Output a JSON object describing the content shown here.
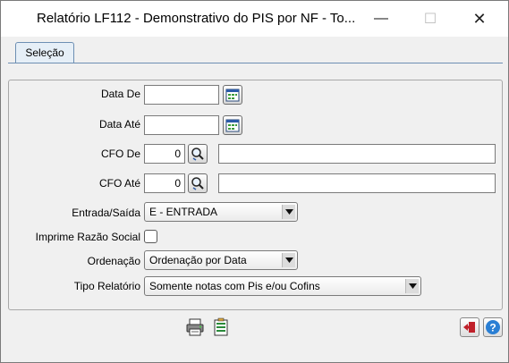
{
  "window": {
    "title": "Relatório LF112 - Demonstrativo do PIS por NF - To...",
    "minimize_glyph": "—",
    "maximize_glyph": "☐",
    "close_glyph": "✕"
  },
  "tabs": [
    {
      "label": "Seleção"
    }
  ],
  "form": {
    "data_de": {
      "label": "Data De",
      "value": ""
    },
    "data_ate": {
      "label": "Data Até",
      "value": ""
    },
    "cfo_de": {
      "label": "CFO De",
      "value": "0",
      "description": ""
    },
    "cfo_ate": {
      "label": "CFO Até",
      "value": "0",
      "description": ""
    },
    "entrada_saida": {
      "label": "Entrada/Saída",
      "value": "E - ENTRADA"
    },
    "imprime_razao_social": {
      "label": "Imprime Razão Social",
      "checked": false
    },
    "ordenacao": {
      "label": "Ordenação",
      "value": "Ordenação por Data"
    },
    "tipo_relatorio": {
      "label": "Tipo Relatório",
      "value": "Somente notas com Pis e/ou Cofins"
    }
  },
  "icons": {
    "calendar": "calendar-icon",
    "search": "search-icon",
    "print": "printer-icon",
    "export": "export-icon",
    "exit": "exit-icon",
    "help": "help-icon"
  },
  "colors": {
    "tab_border": "#6d8fb3",
    "tab_fill": "#e6eff7",
    "exit_red": "#c0202a",
    "help_blue": "#2a7fd4"
  }
}
